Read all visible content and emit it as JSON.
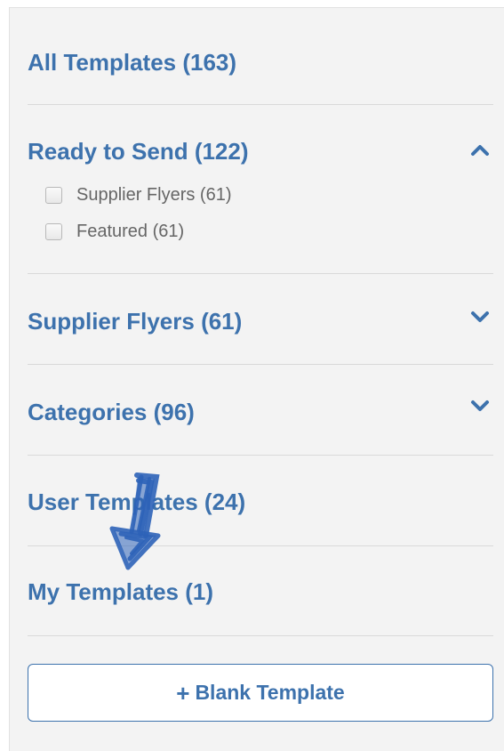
{
  "sidebar": {
    "all_templates": "All Templates (163)",
    "ready_to_send": {
      "label": "Ready to Send (122)",
      "expanded": true,
      "items": [
        {
          "label": "Supplier Flyers (61)",
          "checked": false
        },
        {
          "label": "Featured (61)",
          "checked": false
        }
      ]
    },
    "supplier_flyers": {
      "label": "Supplier Flyers (61)",
      "expanded": false
    },
    "categories": {
      "label": "Categories (96)",
      "expanded": false
    },
    "user_templates": "User Templates (24)",
    "my_templates": "My Templates (1)",
    "blank_template_button": {
      "icon": "+",
      "label": "Blank Template"
    }
  },
  "icons": {
    "ready_to_send_toggle": "chevron-up-icon",
    "supplier_flyers_toggle": "chevron-down-icon",
    "categories_toggle": "chevron-down-icon",
    "annotation": "hand-drawn-arrow-icon"
  },
  "colors": {
    "accent": "#3d72ad",
    "panel_background": "#f3f3f3",
    "divider": "#d9d9d9",
    "muted_text": "#666666"
  }
}
